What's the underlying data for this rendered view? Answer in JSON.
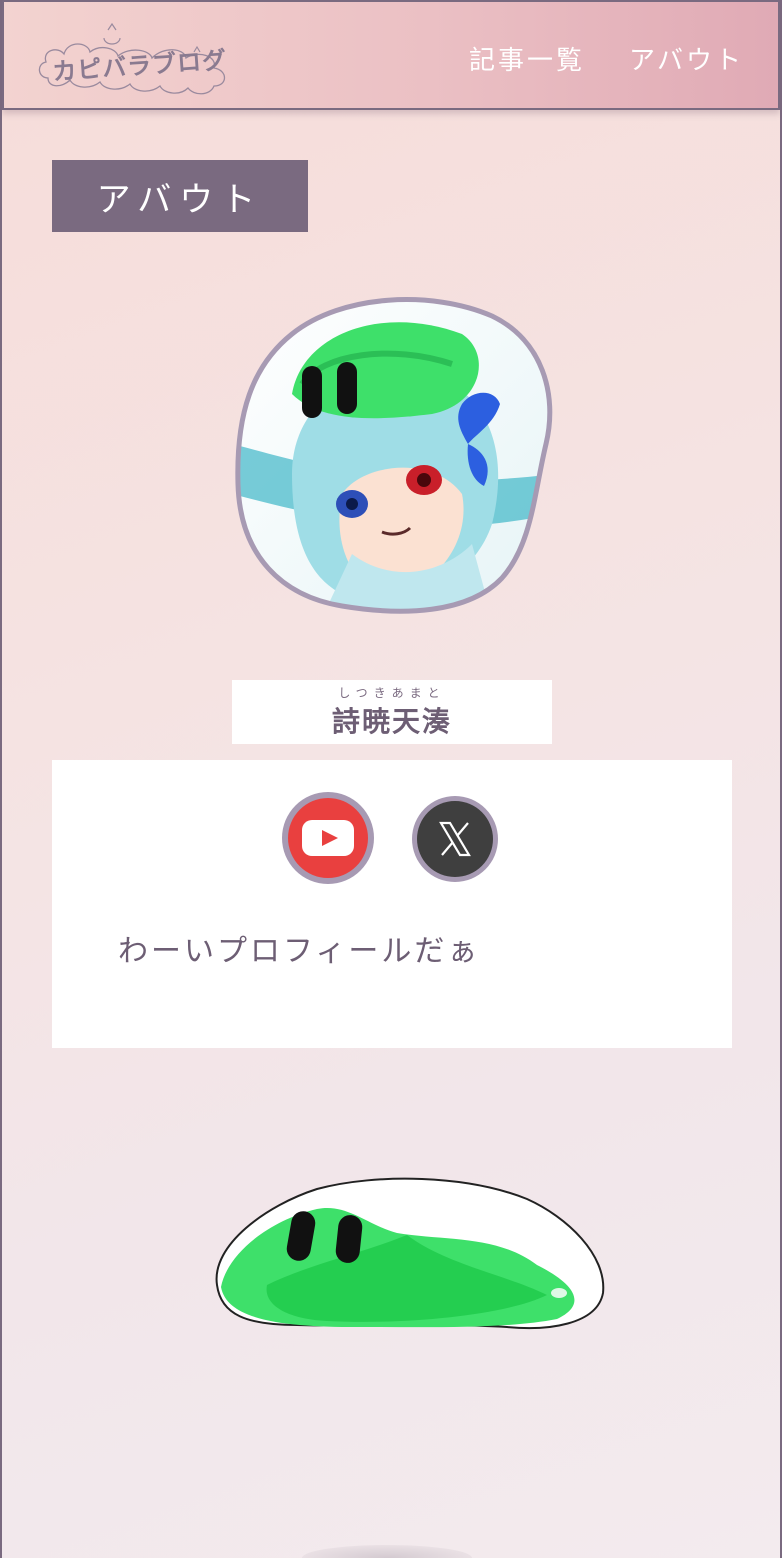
{
  "header": {
    "logo_text": "カピバラブログ",
    "nav": [
      {
        "label": "記事一覧"
      },
      {
        "label": "アバウト"
      }
    ]
  },
  "page": {
    "title": "アバウト"
  },
  "profile": {
    "name_ruby": "しつきあまと",
    "name": "詩暁天湊",
    "bio": "わーいプロフィールだぁ",
    "social": [
      {
        "icon": "youtube-icon",
        "color": "#e9403f"
      },
      {
        "icon": "x-icon",
        "color": "#3f3f3f"
      }
    ]
  },
  "colors": {
    "accent": "#7a6a80",
    "header_start": "#f3d3d0",
    "header_end": "#e0aab5"
  }
}
